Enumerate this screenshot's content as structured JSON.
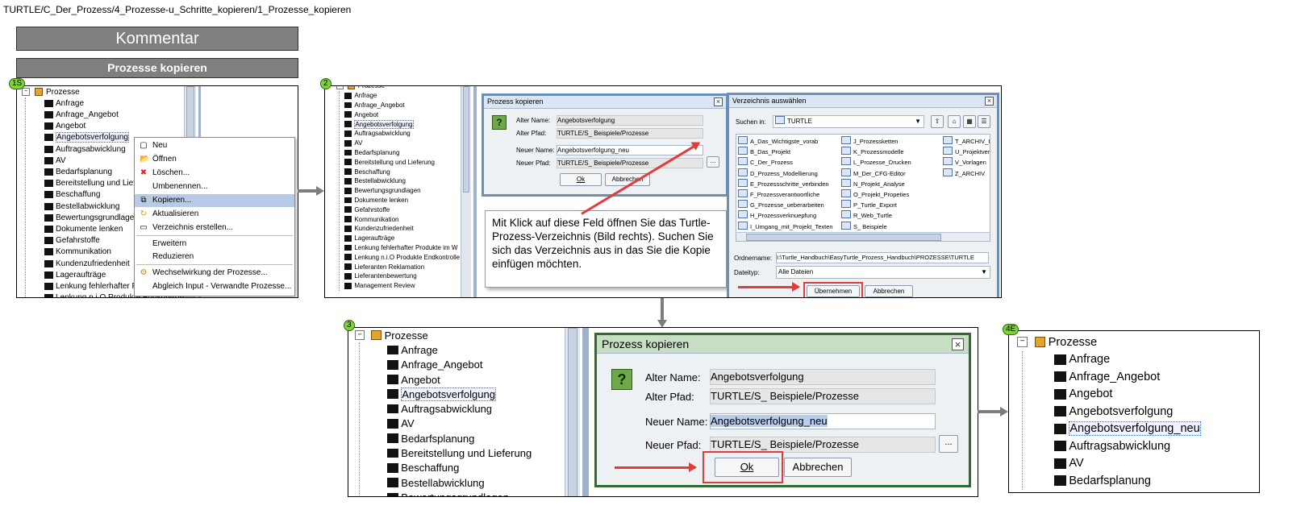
{
  "breadcrumb": "TURTLE/C_Der_Prozess/4_Prozesse-u_Schritte_kopieren/1_Prozesse_kopieren",
  "headers": {
    "kommentar": "Kommentar",
    "prozesse_kopieren": "Prozesse kopieren"
  },
  "badges": {
    "p1": "1S",
    "p2": "2",
    "p3": "3",
    "p4": "4E"
  },
  "tree": {
    "root": "Prozesse",
    "minus": "−",
    "p1_items": [
      "Anfrage",
      "Anfrage_Angebot",
      "Angebot",
      "Angebotsverfolgung",
      "Auftragsabwicklung",
      "AV",
      "Bedarfsplanung",
      "Bereitstellung und Lief",
      "Beschaffung",
      "Bestellabwicklung",
      "Bewertungsgrundlage",
      "Dokumente lenken",
      "Gefahrstoffe",
      "Kommunikation",
      "Kundenzufriedenheit",
      "Lageraufträge",
      "Lenkung fehlerhafter F",
      "Lenkung n.i.O Produkte Endkontrolle"
    ],
    "p2_items": [
      "Anfrage",
      "Anfrage_Angebot",
      "Angebot",
      "Angebotsverfolgung",
      "Auftragsabwicklung",
      "AV",
      "Bedarfsplanung",
      "Bereitstellung und Lieferung",
      "Beschaffung",
      "Bestellabwicklung",
      "Bewertungsgrundlagen",
      "Dokumente lenken",
      "Gefahrstoffe",
      "Kommunikation",
      "Kundenzufriedenheit",
      "Lageraufträge",
      "Lenkung fehlerhafter Produkte im W",
      "Lenkung n.i.O Produkte Endkontrolle",
      "Lieferanten Reklamation",
      "Lieferantenbewertung",
      "Management Review"
    ],
    "p3_items": [
      "Anfrage",
      "Anfrage_Angebot",
      "Angebot",
      "Angebotsverfolgung",
      "Auftragsabwicklung",
      "AV",
      "Bedarfsplanung",
      "Bereitstellung und Lieferung",
      "Beschaffung",
      "Bestellabwicklung",
      "Bewertungsgrundlagen"
    ],
    "p4_items": [
      "Anfrage",
      "Anfrage_Angebot",
      "Angebot",
      "Angebotsverfolgung",
      "Angebotsverfolgung_neu",
      "Auftragsabwicklung",
      "AV",
      "Bedarfsplanung"
    ]
  },
  "context_menu": {
    "items": [
      {
        "label": "Neu",
        "icon": "new-document-icon",
        "glyph": "▢"
      },
      {
        "label": "Öffnen",
        "icon": "open-folder-icon",
        "glyph": "📂"
      },
      {
        "label": "Löschen...",
        "icon": "delete-icon",
        "glyph": "✖"
      },
      {
        "label": "Umbenennen...",
        "icon": "",
        "glyph": ""
      },
      {
        "label": "Kopieren...",
        "icon": "copy-icon",
        "glyph": "⧉"
      },
      {
        "label": "Aktualisieren",
        "icon": "refresh-icon",
        "glyph": "↻"
      },
      {
        "label": "Verzeichnis erstellen...",
        "icon": "create-folder-icon",
        "glyph": "▭"
      },
      {
        "label": "Erweitern",
        "icon": "",
        "glyph": ""
      },
      {
        "label": "Reduzieren",
        "icon": "",
        "glyph": ""
      },
      {
        "label": "Wechselwirkung der Prozesse...",
        "icon": "interaction-icon",
        "glyph": "⚙"
      },
      {
        "label": "Abgleich Input - Verwandte Prozesse...",
        "icon": "",
        "glyph": ""
      }
    ]
  },
  "copy_dialog": {
    "title": "Prozess kopieren",
    "q": "?",
    "alter_name_label": "Alter Name:",
    "alter_name": "Angebotsverfolgung",
    "alter_pfad_label": "Alter Pfad:",
    "alter_pfad": "TURTLE/S_ Beispiele/Prozesse",
    "neuer_name_label": "Neuer Name:",
    "neuer_name": "Angebotsverfolgung_neu",
    "neuer_pfad_label": "Neuer Pfad:",
    "neuer_pfad": "TURTLE/S_ Beispiele/Prozesse",
    "browse": "...",
    "ok": "Ok",
    "abbrechen": "Abbrechen",
    "close": "×"
  },
  "callout": "Mit Klick auf diese Feld öffnen Sie das Turtle-Prozess-Verzeichnis (Bild rechts). Suchen Sie sich das Verzeichnis aus in das Sie die Kopie einfügen möchten.",
  "dir_dialog": {
    "title": "Verzeichnis auswählen",
    "close": "×",
    "suchen_label": "Suchen in:",
    "suchen_value": "TURTLE",
    "col1": [
      "A_Das_Wichtigste_vorab",
      "B_Das_Projekt",
      "C_Der_Prozess",
      "D_Prozess_Modellierung",
      "E_Prozessschritte_verbinden",
      "F_Prozessverantwortliche",
      "G_Prozesse_ueberarbeiten",
      "H_Prozessverknuepfung",
      "I_Umgang_mit_Projekt_Texten"
    ],
    "col2": [
      "J_Prozessketten",
      "K_Prozessmodelle",
      "L_Prozesse_Drucken",
      "M_Der_CFG-Editor",
      "N_Projekt_Analyse",
      "O_Projekt_Propeties",
      "P_Turtle_Export",
      "R_Web_Turtle",
      "S_ Beispiele"
    ],
    "col3": [
      "T_ARCHIV_I",
      "U_Projektver",
      "V_Vorlagen",
      "Z_ARCHIV"
    ],
    "ordnername_label": "Ordnername:",
    "ordnername": "I:\\Turtle_Handbuch\\EasyTurtle_Prozess_Handbuch\\PROZESSE\\TURTLE",
    "dateityp_label": "Dateityp:",
    "dateityp": "Alle Dateien",
    "uebernehmen": "Übernehmen",
    "abbrechen": "Abbrechen"
  },
  "colors": {
    "accent_red": "#e23b3b",
    "header_gray": "#7f7f7f",
    "badge_green": "#7fd23c"
  }
}
